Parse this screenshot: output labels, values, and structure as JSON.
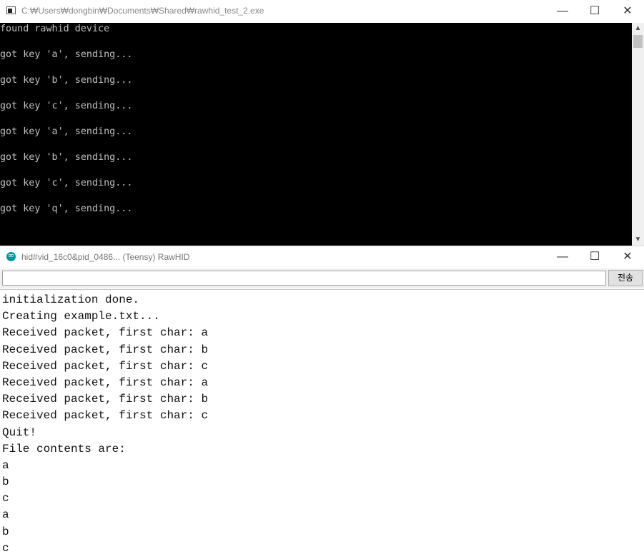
{
  "console_window": {
    "title": "C:₩Users₩dongbin₩Documents₩Shared₩rawhid_test_2.exe",
    "minimize": "—",
    "maximize": "☐",
    "close": "✕",
    "lines": [
      "found rawhid device",
      "got key 'a', sending...",
      "got key 'b', sending...",
      "got key 'c', sending...",
      "got key 'a', sending...",
      "got key 'b', sending...",
      "got key 'c', sending...",
      "got key 'q', sending..."
    ],
    "scroll_up": "▲",
    "scroll_down": "▼"
  },
  "serial_window": {
    "title": "hid#vid_16c0&pid_0486... (Teensy) RawHID",
    "minimize": "—",
    "maximize": "☐",
    "close": "✕",
    "send_input_value": "",
    "send_button": "전송",
    "lines": [
      "initialization done.",
      "Creating example.txt...",
      "Received packet, first char: a",
      "Received packet, first char: b",
      "Received packet, first char: c",
      "Received packet, first char: a",
      "Received packet, first char: b",
      "Received packet, first char: c",
      "Quit!",
      "File contents are:",
      "a",
      "b",
      "c",
      "a",
      "b",
      "c"
    ]
  },
  "colors": {
    "console_bg": "#000000",
    "console_text": "#c0c0c0",
    "arduino_icon": "#00979c"
  },
  "icons": {
    "console_icon": "console-app-icon",
    "serial_icon": "arduino-icon"
  }
}
